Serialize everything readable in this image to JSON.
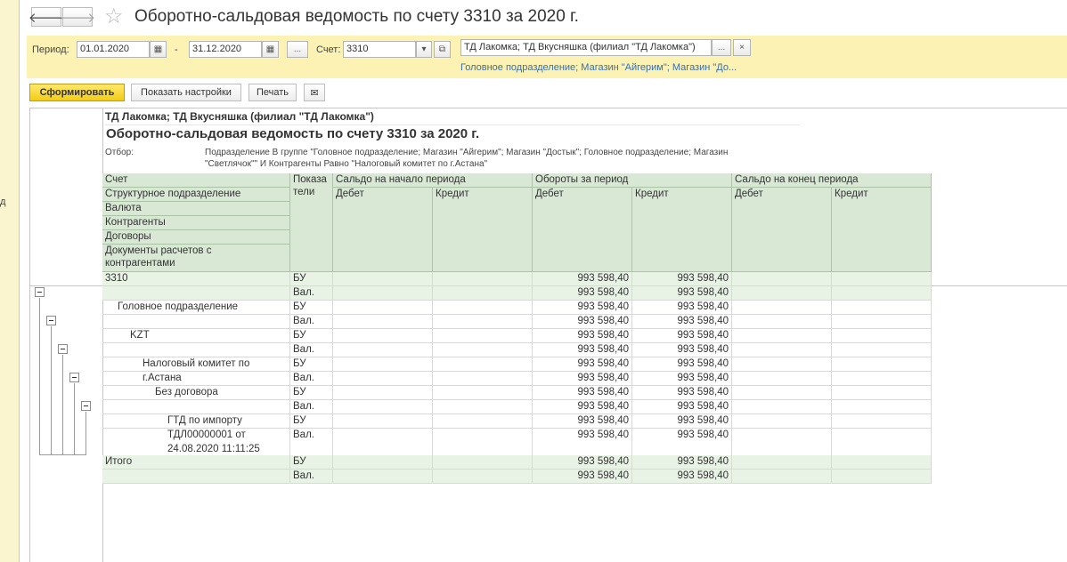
{
  "window": {
    "title": "Оборотно-сальдовая ведомость по счету 3310  за 2020 г.",
    "left_strip_char": "д"
  },
  "nav": {
    "back": "🡐",
    "forward": "🡒",
    "favorite": "☆"
  },
  "params": {
    "period_label": "Период:",
    "date_from": "01.01.2020",
    "date_to": "31.12.2020",
    "dash": "-",
    "ellipsis": "...",
    "account_label": "Счет:",
    "account_value": "3310",
    "org_value": "ТД Лакомка; ТД Вкусняшка (филиал \"ТД Лакомка\")",
    "clear": "×",
    "filter_link": "Головное подразделение; Магазин \"Айгерим\"; Магазин \"До..."
  },
  "toolbar": {
    "generate": "Сформировать",
    "settings": "Показать настройки",
    "print": "Печать"
  },
  "report": {
    "org": "ТД Лакомка; ТД Вкусняшка (филиал \"ТД Лакомка\")",
    "title": "Оборотно-сальдовая ведомость по счету 3310  за 2020 г.",
    "otbor_label": "Отбор:",
    "otbor_line1": "Подразделение В группе \"Головное подразделение; Магазин \"Айгерим\"; Магазин \"Достык\"; Головное подразделение; Магазин",
    "otbor_line2": "\"Светлячок\"\" И Контрагенты Равно \"Налоговый комитет по г.Астана\"",
    "headers": {
      "schet": "Счет",
      "struct": "Структурное подразделение",
      "valuta": "Валюта",
      "kontr": "Контрагенты",
      "dogovory": "Договоры",
      "docs1": "Документы расчетов с",
      "docs2": "контрагентами",
      "pokaz1": "Показа",
      "pokaz2": "тели",
      "saldo_start": "Сальдо на начало периода",
      "oboroty": "Обороты за период",
      "saldo_end": "Сальдо на конец периода",
      "debet": "Дебет",
      "kredit": "Кредит"
    },
    "rows": [
      {
        "label": "3310",
        "ind": "БУ",
        "od": "993 598,40",
        "ok": "993 598,40"
      },
      {
        "label": "",
        "ind": "Вал.",
        "od": "993 598,40",
        "ok": "993 598,40"
      },
      {
        "label": "Головное подразделение",
        "ind": "БУ",
        "od": "993 598,40",
        "ok": "993 598,40"
      },
      {
        "label": "",
        "ind": "Вал.",
        "od": "993 598,40",
        "ok": "993 598,40"
      },
      {
        "label": "KZT",
        "ind": "БУ",
        "od": "993 598,40",
        "ok": "993 598,40"
      },
      {
        "label": "",
        "ind": "Вал.",
        "od": "993 598,40",
        "ok": "993 598,40"
      },
      {
        "label": "Налоговый комитет по",
        "ind": "БУ",
        "od": "993 598,40",
        "ok": "993 598,40"
      },
      {
        "label": "г.Астана",
        "ind": "Вал.",
        "od": "993 598,40",
        "ok": "993 598,40"
      },
      {
        "label": "Без договора",
        "ind": "БУ",
        "od": "993 598,40",
        "ok": "993 598,40"
      },
      {
        "label": "",
        "ind": "Вал.",
        "od": "993 598,40",
        "ok": "993 598,40"
      },
      {
        "label": "ГТД по импорту",
        "ind": "БУ",
        "od": "993 598,40",
        "ok": "993 598,40"
      },
      {
        "label": "ТДЛ00000001 от",
        "ind": "Вал.",
        "od": "993 598,40",
        "ok": "993 598,40"
      },
      {
        "label": "24.08.2020 11:11:25",
        "ind": "",
        "od": "",
        "ok": ""
      },
      {
        "label": "Итого",
        "ind": "БУ",
        "od": "993 598,40",
        "ok": "993 598,40"
      },
      {
        "label": "",
        "ind": "Вал.",
        "od": "993 598,40",
        "ok": "993 598,40"
      }
    ]
  }
}
